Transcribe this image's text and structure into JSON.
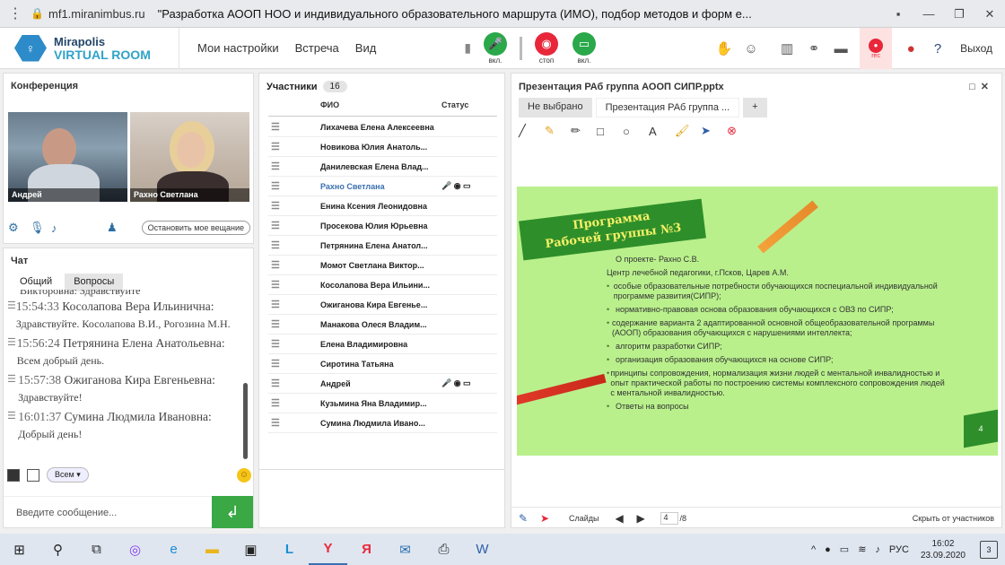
{
  "browser": {
    "url": "mf1.miranimbus.ru",
    "title": "\"Разработка АООП НОО и индивидуального образовательного маршрута (ИМО), подбор методов и форм е...",
    "menu_icon": "more-vert-icon",
    "lock_icon": "lock-icon"
  },
  "app": {
    "logo_line1": "Mirapolis",
    "logo_line2": "VIRTUAL ROOM",
    "nav": [
      "Мои настройки",
      "Встреча",
      "Вид"
    ],
    "mic_label": "вкл.",
    "stop_label": "стоп",
    "screen_label": "вкл.",
    "rec_label": "rec",
    "exit_label": "Выход"
  },
  "conference": {
    "title": "Конференция",
    "videos": [
      {
        "name": "Андрей"
      },
      {
        "name": "Рахно Светлана"
      }
    ],
    "stop_broadcast": "Остановить мое вещание"
  },
  "chat": {
    "title": "Чат",
    "tabs": [
      "Общий",
      "Вопросы"
    ],
    "partial_line": "Викторовна: Здравствуйте",
    "messages": [
      {
        "time": "15:54:33",
        "author": "Косолапова Вера Ильинична:",
        "text": "Здравствуйте. Косолапова В.И., Рогозина М.Н."
      },
      {
        "time": "15:56:24",
        "author": "Петрянина Елена Анатольевна:",
        "text": "Всем добрый день."
      },
      {
        "time": "15:57:38",
        "author": "Ожиганова  Кира Евгеньевна:",
        "text": "Здравствуйте!"
      },
      {
        "time": "16:01:37",
        "author": "Сумина Людмила Ивановна:",
        "text": "Добрый день!"
      }
    ],
    "recipient": "Всем",
    "input_placeholder": "Введите сообщение...",
    "send_icon": "↲"
  },
  "participants": {
    "title": "Участники",
    "count": "16",
    "col_name": "ФИО",
    "col_status": "Статус",
    "rows": [
      {
        "name": "Лихачева Елена Алексеевна",
        "highlight": false,
        "icons": ""
      },
      {
        "name": "Новикова Юлия  Анатоль...",
        "highlight": false,
        "icons": ""
      },
      {
        "name": "Данилевская Елена  Влад...",
        "highlight": false,
        "icons": ""
      },
      {
        "name": "Рахно Светлана",
        "highlight": true,
        "icons": "🎤 ◉ ▭"
      },
      {
        "name": "Енина Ксения  Леонидовна",
        "highlight": false,
        "icons": ""
      },
      {
        "name": "Просекова  Юлия  Юрьевна",
        "highlight": false,
        "icons": ""
      },
      {
        "name": "Петрянина Елена  Анатол...",
        "highlight": false,
        "icons": ""
      },
      {
        "name": "Момот Светлана   Виктор...",
        "highlight": false,
        "icons": ""
      },
      {
        "name": "Косолапова Вера Ильини...",
        "highlight": false,
        "icons": ""
      },
      {
        "name": "Ожиганова  Кира Евгенье...",
        "highlight": false,
        "icons": ""
      },
      {
        "name": "Манакова Олеся  Владим...",
        "highlight": false,
        "icons": ""
      },
      {
        "name": "Елена Владимировна",
        "highlight": false,
        "icons": ""
      },
      {
        "name": "Сиротина Татьяна",
        "highlight": false,
        "icons": ""
      },
      {
        "name": "Андрей",
        "highlight": false,
        "icons": "🎤 ◉ ▭"
      },
      {
        "name": "Кузьмина  Яна  Владимир...",
        "highlight": false,
        "icons": ""
      },
      {
        "name": "Сумина Людмила  Ивано...",
        "highlight": false,
        "icons": ""
      }
    ]
  },
  "presentation": {
    "title": "Презентация РАб группа АООП СИПР.pptx",
    "tabs": [
      "Не выбрано",
      "Презентация РАб группа ...",
      "+"
    ],
    "slide": {
      "banner_line1": "Программа",
      "banner_line2": "Рабочей группы №3",
      "intro1": "О проекте- Рахно С.В.",
      "intro2": "Центр лечебной педагогики, г.Псков, Царев А.М.",
      "bullets": [
        "особые образовательные потребности обучающихся поспециальной индивидуальной программе развития(СИПР);",
        "нормативно-правовая основа образования обучающихся с ОВЗ по СИПР;",
        "содержание варианта 2 адаптированной основной общеобразовательной программы (АООП) образования обучающихся с нарушениями интеллекта;",
        "алгоритм разработки СИПР;",
        "организация образования обучающихся на основе СИПР;",
        "принципы сопровождения, нормализация жизни людей с ментальной инвалидностью и опыт практической работы по построению системы комплексного сопровождения людей с ментальной инвалидностью.",
        "Ответы на вопросы"
      ],
      "page_number": "4"
    },
    "footer": {
      "slides_label": "Слайды",
      "current_page": "4",
      "total_pages": "/8",
      "hide_label": "Скрыть от участников"
    }
  },
  "taskbar": {
    "lang": "РУС",
    "time": "16:02",
    "date": "23.09.2020",
    "notifications": "3"
  }
}
